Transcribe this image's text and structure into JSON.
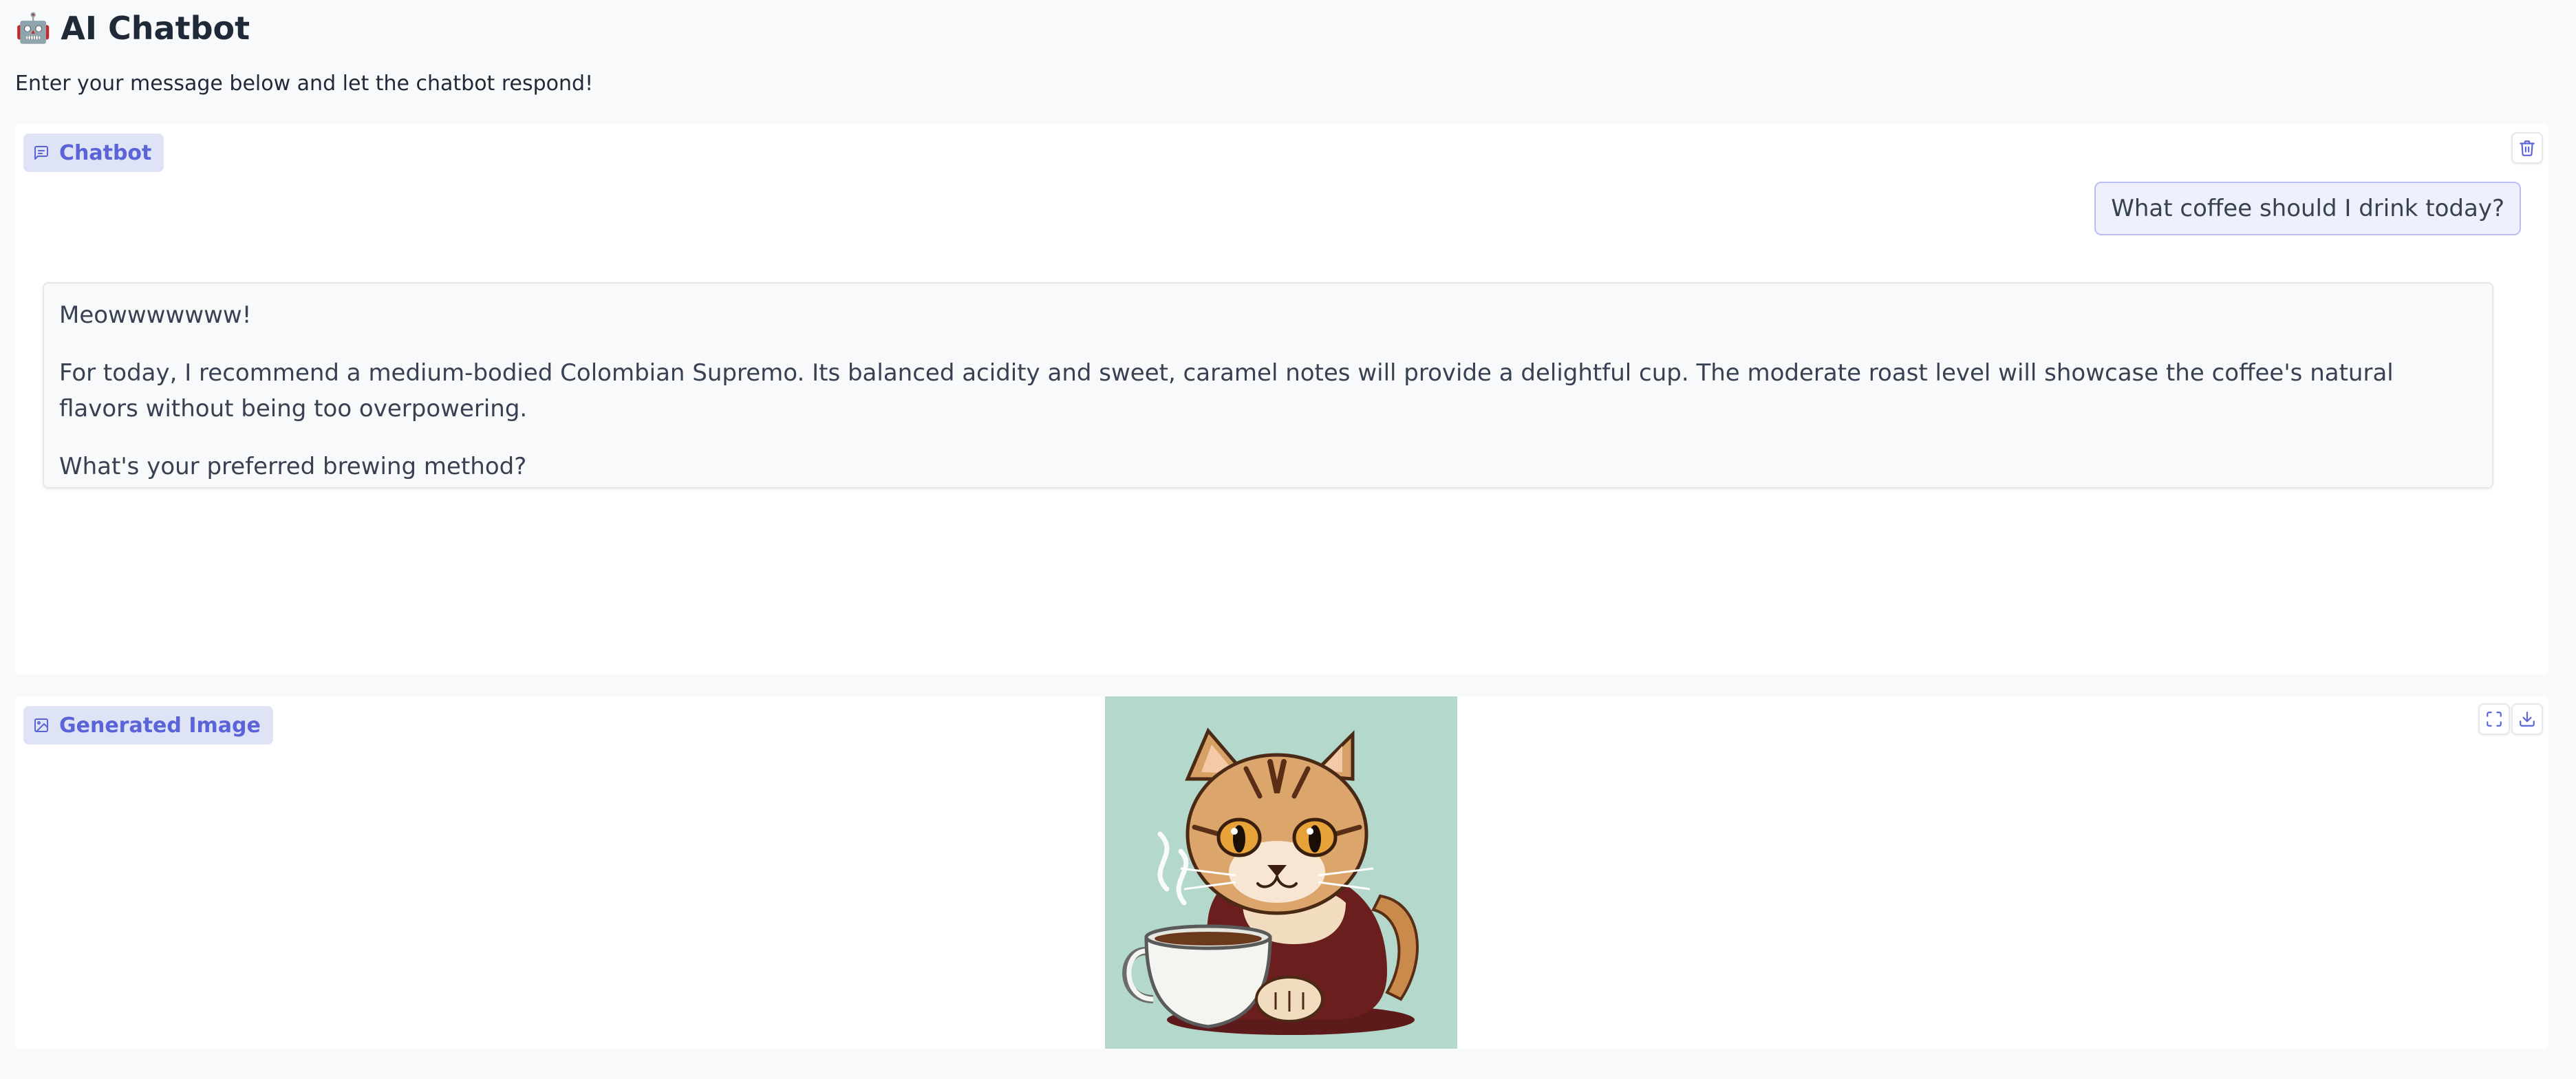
{
  "header": {
    "title": "AI Chatbot",
    "subtitle": "Enter your message below and let the chatbot respond!"
  },
  "chatbot": {
    "label": "Chatbot",
    "messages": [
      {
        "role": "user",
        "text": "What coffee should I drink today?"
      },
      {
        "role": "bot",
        "paragraphs": [
          "Meowwwwwww!",
          "For today, I recommend a medium-bodied Colombian Supremo. Its balanced acidity and sweet, caramel notes will provide a delightful cup. The moderate roast level will showcase the coffee's natural flavors without being too overpowering.",
          "What's your preferred brewing method?"
        ]
      }
    ]
  },
  "image_panel": {
    "label": "Generated Image"
  },
  "icons": {
    "title_icon": "🤖",
    "chatbot_label_icon": "chat-icon",
    "clear_button_icon": "trash-icon",
    "image_label_icon": "image-icon",
    "fullscreen_button_icon": "fullscreen-icon",
    "download_button_icon": "download-icon"
  },
  "colors": {
    "accent": "#5a63d8",
    "label_bg": "#dfe3f6",
    "user_bubble_bg": "#eef0fb",
    "user_bubble_border": "#b9bff0",
    "image_bg": "#b5d8cc"
  }
}
